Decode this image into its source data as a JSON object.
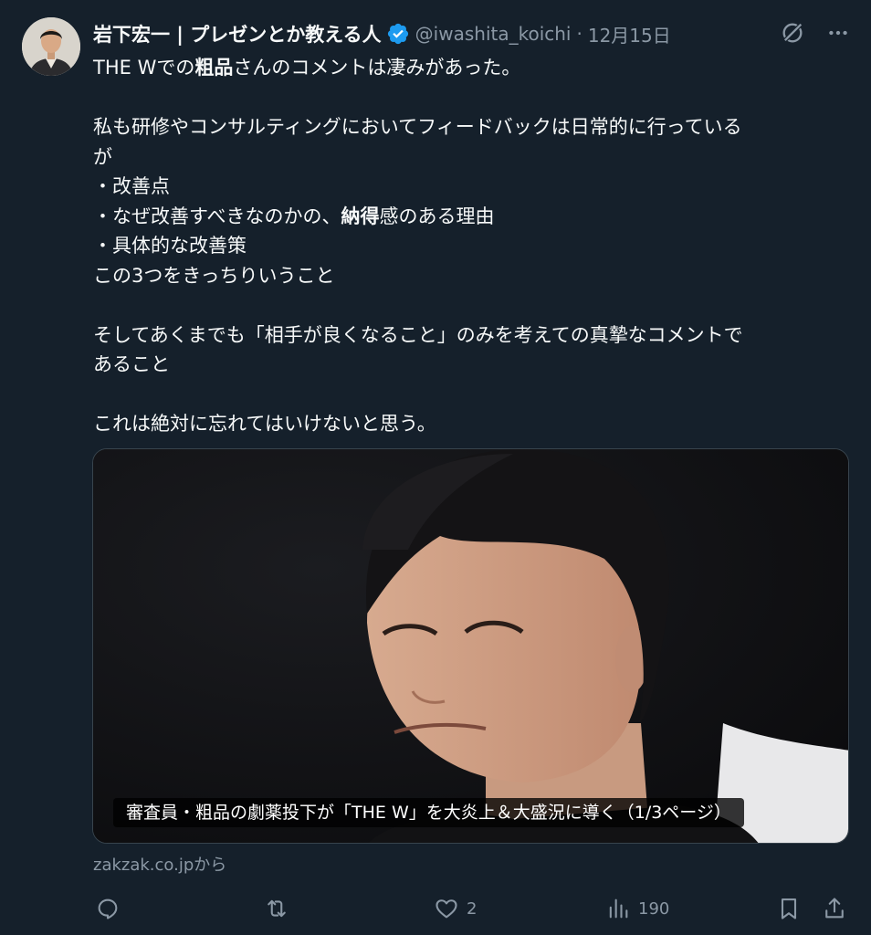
{
  "author": {
    "display_name": "岩下宏一 | プレゼンとか教える人",
    "handle": "@iwashita_koichi",
    "separator": "·",
    "date": "12月15日",
    "verified": true
  },
  "tweet": {
    "lines": [
      "THE Wでの粗品さんのコメントは凄みがあった。",
      "",
      "私も研修やコンサルティングにおいてフィードバックは日常的に行っている",
      "が",
      "・改善点",
      "・なぜ改善すべきなのかの、納得感のある理由",
      "・具体的な改善策",
      "この3つをきっちりいうこと",
      "",
      "そしてあくまでも「相手が良くなること」のみを考えての真摯なコメントで",
      "あること",
      "",
      "これは絶対に忘れてはいけないと思う。"
    ],
    "bold_words": [
      "粗品",
      "納得"
    ]
  },
  "card": {
    "caption": "審査員・粗品の劇薬投下が「THE W」を大炎上＆大盛況に導く（1/3ページ）",
    "source": "zakzak.co.jpから"
  },
  "actions": {
    "reply_count": "",
    "retweet_count": "",
    "like_count": "2",
    "views_count": "190"
  },
  "icons": {
    "verified": "verified-badge-icon",
    "grok": "grok-icon",
    "more": "more-icon",
    "reply": "reply-icon",
    "retweet": "retweet-icon",
    "like": "heart-icon",
    "views": "views-icon",
    "bookmark": "bookmark-icon",
    "share": "share-icon"
  },
  "colors": {
    "background": "#15202b",
    "text": "#f7f9f9",
    "muted": "#8b98a5",
    "verified": "#1d9bf0",
    "border": "#38444d"
  }
}
